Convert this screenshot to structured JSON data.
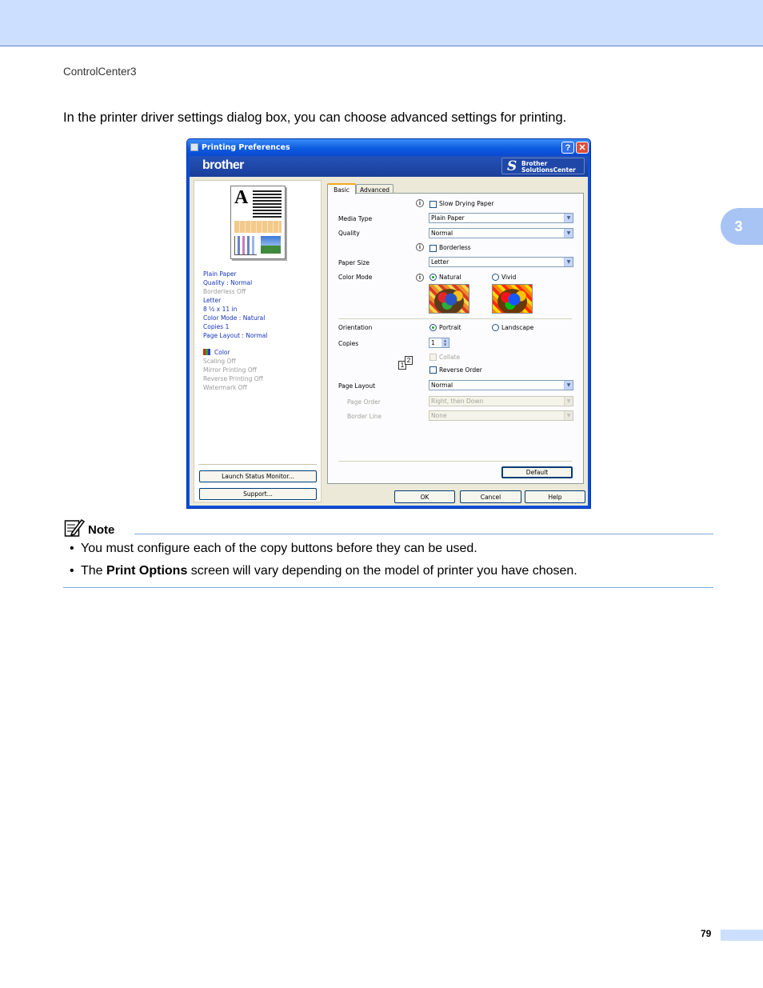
{
  "header": {
    "running_title": "ControlCenter3",
    "chapter_number": "3"
  },
  "intro_text": "In the printer driver settings dialog box, you can choose advanced settings for printing.",
  "dialog": {
    "title": "Printing Preferences",
    "help_btn": "?",
    "close_btn": "✕",
    "brand": "brother",
    "solutions_line1": "Brother",
    "solutions_line2": "SolutionsCenter",
    "preview_letter": "A",
    "summary": [
      {
        "text": "Plain Paper",
        "active": true
      },
      {
        "text": "Quality : Normal",
        "active": true
      },
      {
        "text": "Borderless Off",
        "active": false
      },
      {
        "text": "Letter",
        "active": true
      },
      {
        "text": "8 ½ x 11 in",
        "active": true
      },
      {
        "text": "Color Mode : Natural",
        "active": true
      },
      {
        "text": "Copies 1",
        "active": true
      },
      {
        "text": "Page Layout : Normal",
        "active": true
      }
    ],
    "summary2": [
      {
        "text": "Color",
        "active": true
      },
      {
        "text": "Scaling Off",
        "active": false
      },
      {
        "text": "Mirror Printing Off",
        "active": false
      },
      {
        "text": "Reverse Printing Off",
        "active": false
      },
      {
        "text": "Watermark Off",
        "active": false
      }
    ],
    "launch_status_monitor": "Launch Status Monitor...",
    "support": "Support...",
    "tabs": {
      "basic": "Basic",
      "advanced": "Advanced"
    },
    "slow_drying_paper": "Slow Drying Paper",
    "media_type_label": "Media Type",
    "media_type_value": "Plain Paper",
    "quality_label": "Quality",
    "quality_value": "Normal",
    "borderless": "Borderless",
    "paper_size_label": "Paper Size",
    "paper_size_value": "Letter",
    "color_mode_label": "Color Mode",
    "color_natural": "Natural",
    "color_vivid": "Vivid",
    "orientation_label": "Orientation",
    "portrait": "Portrait",
    "landscape": "Landscape",
    "copies_label": "Copies",
    "copies_value": "1",
    "collate": "Collate",
    "reverse_order": "Reverse Order",
    "collate_icon_1": "1",
    "collate_icon_2": "2",
    "page_layout_label": "Page Layout",
    "page_layout_value": "Normal",
    "page_order_label": "Page Order",
    "page_order_value": "Right, then Down",
    "border_line_label": "Border Line",
    "border_line_value": "None",
    "default_btn": "Default",
    "ok": "OK",
    "cancel": "Cancel",
    "help": "Help"
  },
  "note": {
    "title": "Note",
    "bullet_marker": "•",
    "item1": "You must configure each of the copy buttons before they can be used.",
    "item2_pre": "The ",
    "item2_bold": "Print Options",
    "item2_post": " screen will vary depending on the model of printer you have chosen."
  },
  "footer": {
    "page_number": "79"
  }
}
